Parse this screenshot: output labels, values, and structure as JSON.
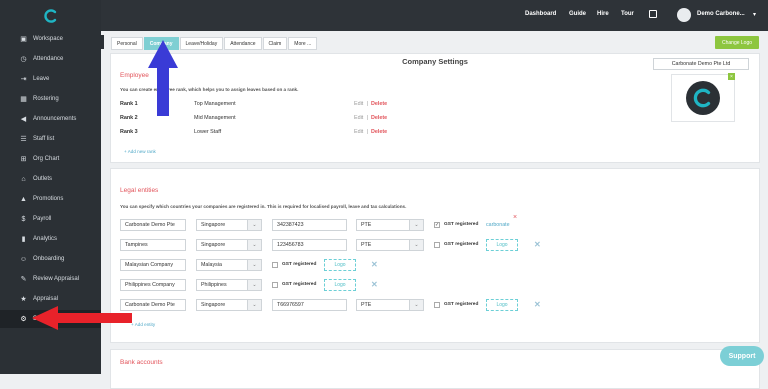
{
  "topbar": {
    "dashboard": "Dashboard",
    "guide": "Guide",
    "hire": "Hire",
    "tour": "Tour",
    "user_name": "Demo Carbone..."
  },
  "sidebar": {
    "items": [
      {
        "label": "Workspace",
        "icon": "workspace-icon"
      },
      {
        "label": "Attendance",
        "icon": "attendance-icon"
      },
      {
        "label": "Leave",
        "icon": "leave-icon"
      },
      {
        "label": "Rostering",
        "icon": "rostering-icon"
      },
      {
        "label": "Announcements",
        "icon": "megaphone-icon"
      },
      {
        "label": "Staff list",
        "icon": "staff-list-icon"
      },
      {
        "label": "Org Chart",
        "icon": "org-chart-icon"
      },
      {
        "label": "Outlets",
        "icon": "outlets-icon"
      },
      {
        "label": "Promotions",
        "icon": "promotions-icon"
      },
      {
        "label": "Payroll",
        "icon": "payroll-icon"
      },
      {
        "label": "Analytics",
        "icon": "analytics-icon"
      },
      {
        "label": "Onboarding",
        "icon": "onboarding-icon"
      },
      {
        "label": "Review Appraisal",
        "icon": "review-appraisal-icon"
      },
      {
        "label": "Appraisal",
        "icon": "appraisal-icon"
      },
      {
        "label": "Settings",
        "icon": "gear-icon"
      }
    ],
    "active": "Settings"
  },
  "tabs": [
    "Personal",
    "Company",
    "Leave/Holiday",
    "Attendance",
    "Claim",
    "More ..."
  ],
  "active_tab": "Company",
  "change_logo": "Change Logo",
  "company": {
    "title": "Company Settings",
    "name": "Carbonate Demo Pte Ltd"
  },
  "ranks": {
    "heading": "Employee",
    "desc": "You can create employee rank, which helps you to assign leaves based on a rank.",
    "rows": [
      {
        "rank": "Rank 1",
        "name": "Top Management",
        "edit": "Edit",
        "sep": "|",
        "del": "Delete"
      },
      {
        "rank": "Rank 2",
        "name": "Mid Management",
        "edit": "Edit",
        "sep": "|",
        "del": "Delete"
      },
      {
        "rank": "Rank 3",
        "name": "Lower Staff",
        "edit": "Edit",
        "sep": "|",
        "del": "Delete"
      }
    ],
    "add": "+ Add new rank"
  },
  "legal": {
    "heading": "Legal entities",
    "desc": "You can specify which countries your companies are registered in. This is required for localised payroll, leave and tax calculations.",
    "gst_label": "GST registered",
    "logo_label": "Logo",
    "rows": [
      {
        "name": "Carbonate Demo Pte",
        "country": "Singapore",
        "reg": "342387423",
        "type": "PTE",
        "gst": true,
        "logo_text": "carbonate"
      },
      {
        "name": "Tampines",
        "country": "Singapore",
        "reg": "123456783",
        "type": "PTE",
        "gst": false,
        "logo_text": "Logo"
      },
      {
        "name": "Malaysian Company",
        "country": "Malaysia",
        "reg": "",
        "type": "",
        "gst": false,
        "logo_text": "Logo"
      },
      {
        "name": "Philippines Company",
        "country": "Philippines",
        "reg": "",
        "type": "",
        "gst": false,
        "logo_text": "Logo"
      },
      {
        "name": "Carbonate Demo Pte",
        "country": "Singapore",
        "reg": "T66976597",
        "type": "PTE",
        "gst": false,
        "logo_text": "Logo"
      }
    ],
    "add": "+ Add entity"
  },
  "bank": {
    "heading": "Bank accounts"
  },
  "support": "Support",
  "colors": {
    "accent": "#1fb5c4",
    "sidebar": "#2b3035",
    "red": "#e2545b",
    "arrow_blue": "#3a3bd6",
    "arrow_red": "#e8222a"
  }
}
